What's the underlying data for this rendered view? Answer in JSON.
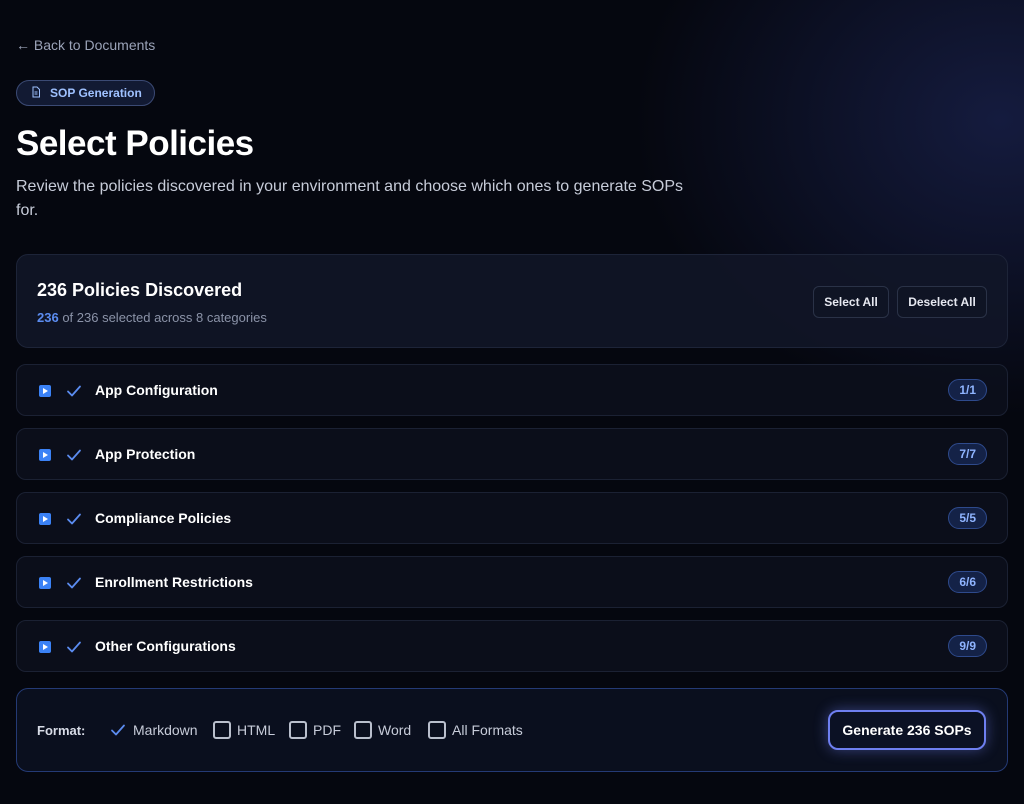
{
  "nav": {
    "back_label": "← Back to Documents"
  },
  "badge": {
    "label": "SOP Generation",
    "icon": "document-icon"
  },
  "header": {
    "title": "Select Policies",
    "subtitle": "Review the policies discovered in your environment and choose which ones to generate SOPs for."
  },
  "summary": {
    "title": "236 Policies Discovered",
    "selected_count": "236",
    "selected_suffix": " of 236 selected across 8 categories",
    "select_all_label": "Select All",
    "deselect_all_label": "Deselect All"
  },
  "categories": [
    {
      "label": "App Configuration",
      "count": "1/1",
      "checked": true
    },
    {
      "label": "App Protection",
      "count": "7/7",
      "checked": true
    },
    {
      "label": "Compliance Policies",
      "count": "5/5",
      "checked": true
    },
    {
      "label": "Enrollment Restrictions",
      "count": "6/6",
      "checked": true
    },
    {
      "label": "Other Configurations",
      "count": "9/9",
      "checked": true
    }
  ],
  "footer": {
    "format_label": "Format:",
    "formats": [
      {
        "label": "Markdown",
        "checked": true
      },
      {
        "label": "HTML",
        "checked": false
      },
      {
        "label": "PDF",
        "checked": false
      },
      {
        "label": "Word",
        "checked": false
      },
      {
        "label": "All Formats",
        "checked": false
      }
    ],
    "generate_label": "Generate 236 SOPs"
  },
  "colors": {
    "accent": "#3b82f6",
    "background": "#05070f",
    "count_badge_bg": "#142247",
    "count_badge_text": "#8fb4ff"
  }
}
